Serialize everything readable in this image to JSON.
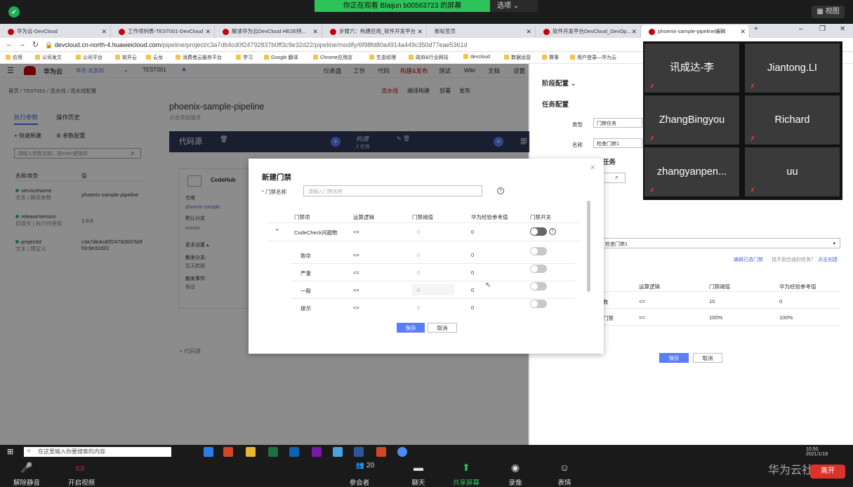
{
  "zoom": {
    "viewing_text": "你正在观看 Blaijun b00563723 的屏幕",
    "options_label": "选项 ⌄",
    "view_label": "视图",
    "participants": [
      "讯成达-李",
      "Jiantong.LI",
      "ZhangBingyou",
      "Richard",
      "zhangyanpen...",
      "uu"
    ],
    "bottom": {
      "mute": "解除静音",
      "video": "开启视频",
      "participants": "参会者",
      "participant_count": "20",
      "chat": "聊天",
      "share": "共享屏幕",
      "record": "录像",
      "reactions": "表情",
      "leave": "离开"
    },
    "watermark": "华为云社区"
  },
  "browser": {
    "tabs": [
      {
        "title": "华为云-DevCloud"
      },
      {
        "title": "工作项列表-TEST001-DevCloud"
      },
      {
        "title": "解读华为云DevCloud HE2E持..."
      },
      {
        "title": "步骤六：构建应用_软件开发平台"
      },
      {
        "title": "新标签页"
      },
      {
        "title": "软件开发平台DevCloud_DevOp..."
      },
      {
        "title": "phoenix-sample-pipeline编辑"
      }
    ],
    "url_host": "devcloud.cn-north-4.huaweicloud.com",
    "url_path": "/pipeline/project/c3a7db4cd0f24792837b0ff3c9e32d22/pipeline/modify/6f98fd80a4914a449c350d77eae5361d",
    "bookmarks": [
      "应用",
      "公司发文",
      "公司平台",
      "软开云",
      "云龙",
      "消费者云服务平台",
      "学习",
      "Google 翻译",
      "Chrome应用店",
      "生态经理",
      "政府&行业网站",
      "devcloud",
      "数据运营",
      "赛事",
      "用户登录—华为云"
    ]
  },
  "app": {
    "brand": "华为云",
    "region": "华北-北京四",
    "project": "TEST001",
    "nav": [
      "仪表盘",
      "工作",
      "代码",
      "构建&发布",
      "测试",
      "Wiki",
      "文档",
      "设置"
    ],
    "breadcrumb": "首页 / TEST001 / 流水线 / 流水线配置",
    "subtabs": [
      "流水线",
      "编译构建",
      "部署",
      "发布"
    ],
    "side": {
      "tab_params": "执行参数",
      "tab_history": "操作历史",
      "quick_new": "快速新建",
      "param_config": "参数配置",
      "search_placeholder": "请输入参数名称，按enter键搜索",
      "col_name": "名称/类型",
      "col_value": "值",
      "params": [
        {
          "name": "serviceName",
          "sub": "文本 | 静态参数",
          "value": "phoenix-sample-pipeline"
        },
        {
          "name": "releaseVersion",
          "sub": "自增长 | 执行时使用",
          "value": "1.0.0"
        },
        {
          "name": "projectId",
          "sub": "文本 | 预定义",
          "value": "c3a7db4cd0f24792837b0f",
          "value2": "f3c9e32d22"
        }
      ]
    },
    "pipeline": {
      "title": "phoenix-sample-pipeline",
      "desc": "点击添加描述",
      "stage_source": "代码源",
      "stage_build": "构建",
      "stage_build_sub": "2 任务",
      "stage_deploy": "部",
      "stage_deploy_sub": "1 任",
      "card": {
        "title": "CodeHub",
        "repo_label": "仓库",
        "repo": "phoenix-sample",
        "branch_label": "默认分支",
        "branch": "master",
        "more": "更多设置 ▴",
        "trigger_branch": "触发分支:",
        "trigger_branch_val": "暂无数据",
        "trigger_event": "触发事件:",
        "trigger_event_val": "推送"
      },
      "add_source": "+ 代码源"
    },
    "right": {
      "stage_config": "阶段配置",
      "task_config": "任务配置",
      "type_label": "类型",
      "type_value": "门禁任务",
      "name_label": "名称",
      "name_value": "检查门禁1",
      "task_header": "任务",
      "select_value": "检查门禁1",
      "edit_link": "编辑已选门禁",
      "hint": "找不到合适的任务？",
      "create_link": "点击创建",
      "cols": [
        "运算逻辑",
        "门禁阈值",
        "华为经验参考值"
      ],
      "rows": [
        {
          "name": "数",
          "op": "<=",
          "threshold": "10",
          "ref": "0"
        },
        {
          "name": "门禁",
          "op": "==",
          "threshold": "100%",
          "ref": "100%"
        }
      ],
      "save": "保存",
      "cancel": "取消"
    }
  },
  "modal": {
    "title": "新建门禁",
    "name_label": "门禁名称",
    "name_placeholder": "请输入门禁名称",
    "cols": [
      "门禁项",
      "运算逻辑",
      "门禁阈值",
      "华为经验参考值",
      "门禁开关"
    ],
    "group": {
      "name": "CodeCheck问题数",
      "op": "<=",
      "threshold": "0",
      "ref": "0"
    },
    "rows": [
      {
        "name": "致命",
        "op": "<=",
        "threshold": "0",
        "ref": "0"
      },
      {
        "name": "严重",
        "op": "<=",
        "threshold": "0",
        "ref": "0"
      },
      {
        "name": "一般",
        "op": "<=",
        "threshold": "0",
        "ref": "0"
      },
      {
        "name": "提示",
        "op": "<=",
        "threshold": "0",
        "ref": "0"
      }
    ],
    "save": "保存",
    "cancel": "取消"
  },
  "taskbar": {
    "search_placeholder": "在这里输入你要搜索的内容",
    "time": "10:50",
    "date": "2021/1/19"
  }
}
